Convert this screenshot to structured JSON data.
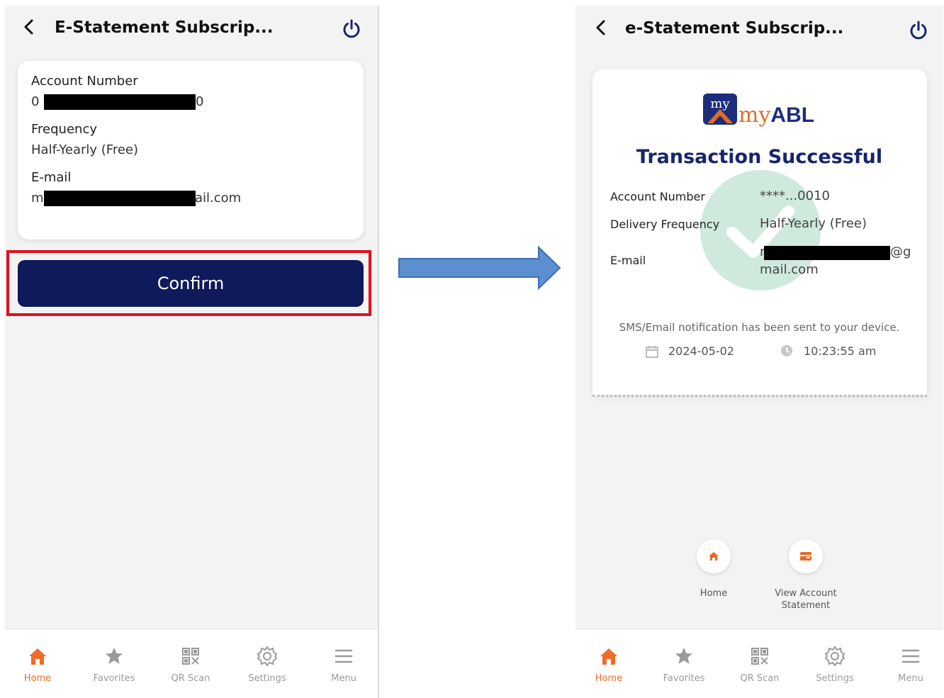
{
  "left": {
    "title": "E-Statement Subscrip...",
    "account_label": "Account Number",
    "account_value_start": "0",
    "account_value_end": "0",
    "frequency_label": "Frequency",
    "frequency_value": "Half-Yearly (Free)",
    "email_label": "E-mail",
    "email_value_start": "m",
    "email_value_end": "ail.com",
    "confirm_label": "Confirm"
  },
  "right": {
    "title": "e-Statement Subscrip...",
    "logo_my": "my",
    "logo_abl": "ABL",
    "success_title": "Transaction Successful",
    "account_label": "Account Number",
    "account_value": "****...0010",
    "frequency_label": "Delivery Frequency",
    "frequency_value": "Half-Yearly (Free)",
    "email_label": "E-mail",
    "email_value_start": "r",
    "email_value_end": "@g",
    "email_value_line2": "mail.com",
    "notification": "SMS/Email notification has been sent to your device.",
    "date": "2024-05-02",
    "time": "10:23:55 am",
    "actions": [
      {
        "label": "Home",
        "icon": "home-icon"
      },
      {
        "label": "View Account Statement",
        "icon": "statement-icon"
      }
    ]
  },
  "nav": [
    {
      "label": "Home",
      "icon": "home-icon",
      "active": true
    },
    {
      "label": "Favorites",
      "icon": "star-icon",
      "active": false
    },
    {
      "label": "QR Scan",
      "icon": "qr-icon",
      "active": false
    },
    {
      "label": "Settings",
      "icon": "gear-icon",
      "active": false
    },
    {
      "label": "Menu",
      "icon": "menu-icon",
      "active": false
    }
  ],
  "colors": {
    "primary": "#0e1a5a",
    "accent": "#ef6b2a",
    "highlight": "#e0101d",
    "arrow": "#5b8fd0"
  }
}
